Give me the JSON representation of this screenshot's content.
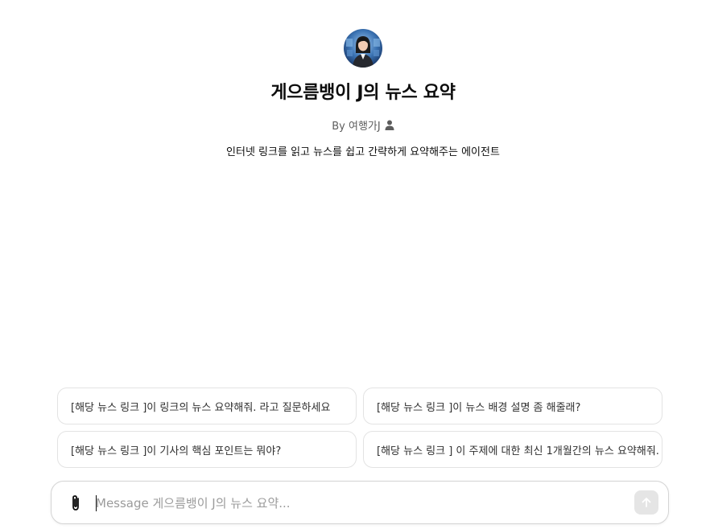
{
  "gpt": {
    "avatar_icon": "profile-avatar",
    "title": "게으름뱅이 J의 뉴스 요약",
    "byline": "By 여행가J",
    "byline_icon": "person-icon",
    "description": "인터넷 링크를 읽고 뉴스를 쉽고 간략하게 요약해주는 에이전트"
  },
  "starters": [
    "[해당 뉴스 링크 ]이 링크의 뉴스 요약해줘. 라고 질문하세요",
    "[해당 뉴스 링크 ]이 뉴스 배경 설명 좀 해줄래?",
    "[해당 뉴스 링크 ]이 기사의 핵심 포인트는 뭐야?",
    "[해당 뉴스 링크 ] 이 주제에 대한 최신 1개월간의 뉴스 요약해줘."
  ],
  "composer": {
    "placeholder": "Message 게으름뱅이 J의 뉴스 요약...",
    "attach_icon": "paperclip-icon",
    "send_icon": "arrow-up-icon"
  },
  "colors": {
    "text": "#0d0d0d",
    "muted": "#5d5d5d",
    "border": "#e3e3e3",
    "send_bg": "#e5e5e5"
  }
}
